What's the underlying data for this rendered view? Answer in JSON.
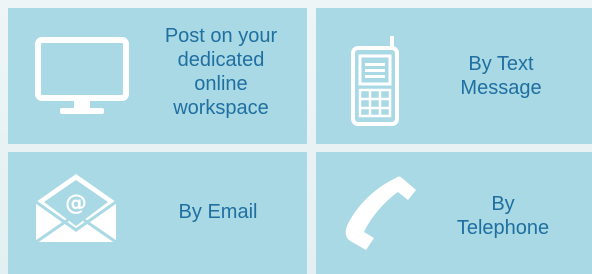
{
  "options": [
    {
      "id": "workspace",
      "label": "Post on your\ndedicated\nonline\nworkspace",
      "icon": "computer-monitor-icon"
    },
    {
      "id": "text",
      "label": "By Text\nMessage",
      "icon": "mobile-phone-icon"
    },
    {
      "id": "email",
      "label": "By Email",
      "icon": "email-envelope-icon"
    },
    {
      "id": "telephone",
      "label": "By\nTelephone",
      "icon": "telephone-handset-icon"
    }
  ],
  "colors": {
    "tile": "#a9d9e4",
    "text": "#1f6fa0",
    "icon": "#ffffff",
    "background": "#eef5f7"
  }
}
